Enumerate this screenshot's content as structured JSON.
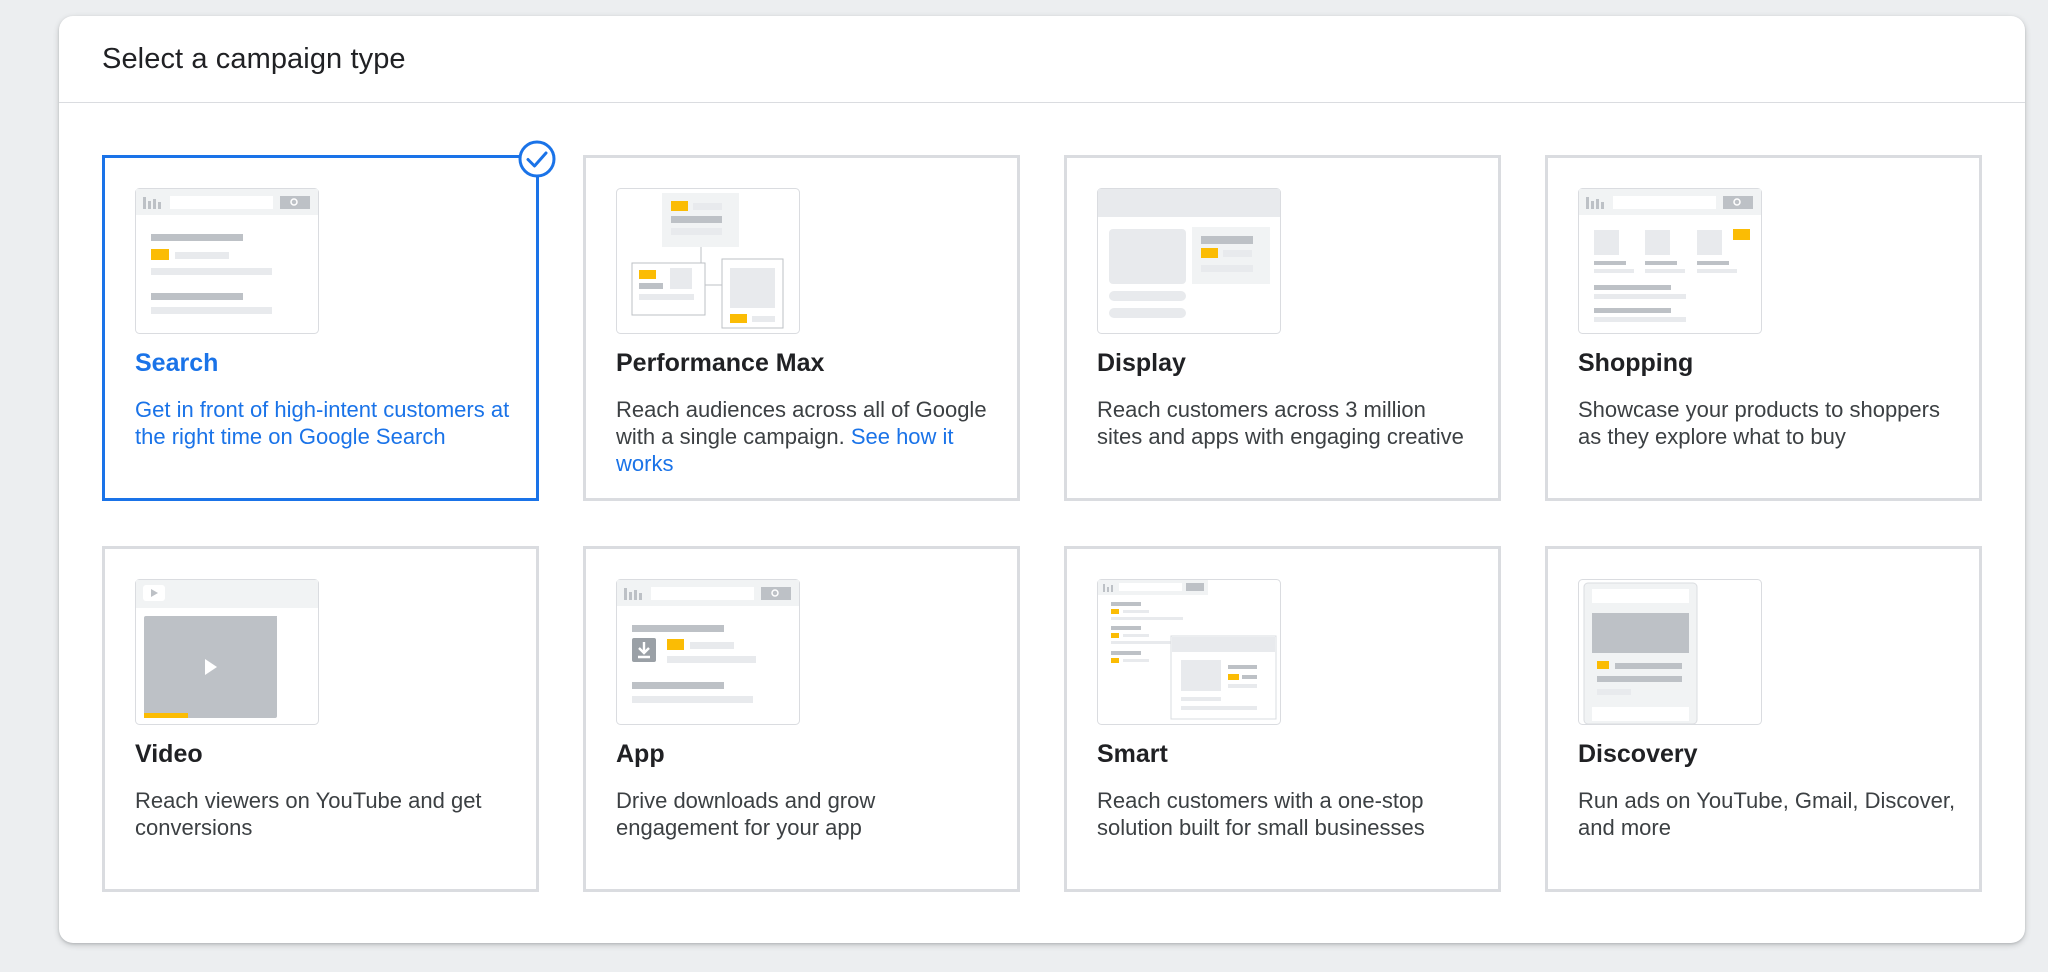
{
  "header": {
    "title": "Select a campaign type"
  },
  "cards": [
    {
      "title": "Search",
      "description": "Get in front of high-intent customers at the right time on Google Search",
      "selected": true
    },
    {
      "title": "Performance Max",
      "description": "Reach audiences across all of Google with a single campaign.",
      "link": "See how it works"
    },
    {
      "title": "Display",
      "description": "Reach customers across 3 million sites and apps with engaging creative"
    },
    {
      "title": "Shopping",
      "description": "Showcase your products to shoppers as they explore what to buy"
    },
    {
      "title": "Video",
      "description": "Reach viewers on YouTube and get conversions"
    },
    {
      "title": "App",
      "description": "Drive downloads and grow engagement for your app"
    },
    {
      "title": "Smart",
      "description": "Reach customers with a one-stop solution built for small businesses"
    },
    {
      "title": "Discovery",
      "description": "Run ads on YouTube, Gmail, Discover, and more"
    }
  ],
  "colors": {
    "accent": "#1a73e8",
    "highlight": "#fbbc04",
    "border": "#dadce0"
  },
  "icons": [
    "selected-check-icon"
  ]
}
